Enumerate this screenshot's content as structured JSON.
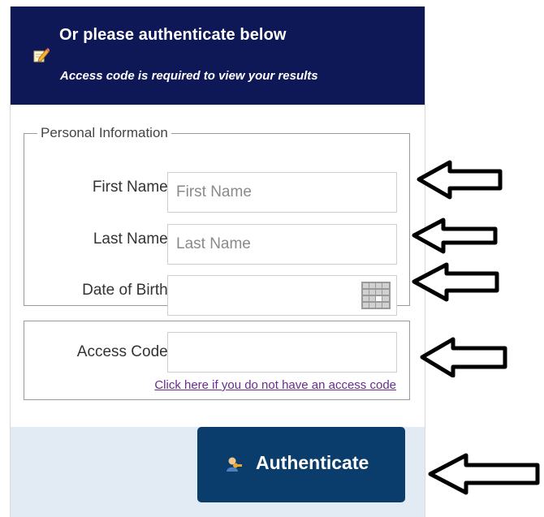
{
  "header": {
    "title": "Or please authenticate below",
    "subtitle": "Access code is required to view your results",
    "icon": "pencil-icon"
  },
  "personal_info": {
    "legend": "Personal Information",
    "first_name": {
      "label": "First Name:",
      "placeholder": "First Name",
      "value": ""
    },
    "last_name": {
      "label": "Last Name:",
      "placeholder": "Last Name",
      "value": ""
    },
    "dob": {
      "label": "Date of Birth:",
      "value": "",
      "icon": "calendar-icon"
    }
  },
  "access": {
    "label": "Access Code:",
    "value": "",
    "link_text": "Click here if you do not have an access code"
  },
  "submit": {
    "label": "Authenticate",
    "icon": "user-key-icon"
  },
  "colors": {
    "header_bg": "#0f1856",
    "button_bg": "#0b3d6c",
    "footer_bg": "#e2ebf3",
    "link": "#6a2b8f"
  },
  "annotations": {
    "arrow_icon": "left-arrow-icon",
    "count": 5
  }
}
